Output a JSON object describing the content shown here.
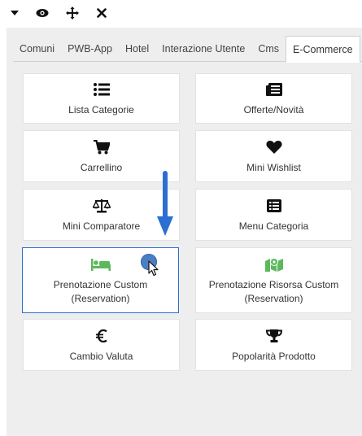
{
  "toolbar": {
    "icons": [
      "caret-down-icon",
      "eye-icon",
      "move-arrows-icon",
      "close-icon"
    ]
  },
  "tabs": [
    {
      "label": "Comuni",
      "active": false
    },
    {
      "label": "PWB-App",
      "active": false
    },
    {
      "label": "Hotel",
      "active": false
    },
    {
      "label": "Interazione Utente",
      "active": false
    },
    {
      "label": "Cms",
      "active": false
    },
    {
      "label": "E-Commerce",
      "active": true
    }
  ],
  "widgets": [
    {
      "label": "Lista Categorie",
      "icon": "list-icon",
      "color": "#111111"
    },
    {
      "label": "Offerte/Novità",
      "icon": "newspaper-icon",
      "color": "#111111"
    },
    {
      "label": "Carrellino",
      "icon": "shopping-cart-icon",
      "color": "#111111"
    },
    {
      "label": "Mini Wishlist",
      "icon": "heart-icon",
      "color": "#111111"
    },
    {
      "label": "Mini Comparatore",
      "icon": "balance-scale-icon",
      "color": "#111111"
    },
    {
      "label": "Menu Categoria",
      "icon": "list-alt-icon",
      "color": "#111111"
    },
    {
      "label": "Prenotazione Custom\n(Reservation)",
      "icon": "bed-icon",
      "color": "#5cb85c",
      "selected": true
    },
    {
      "label": "Prenotazione Risorsa Custom\n(Reservation)",
      "icon": "map-marker-icon",
      "color": "#5cb85c"
    },
    {
      "label": "Cambio Valuta",
      "icon": "euro-icon",
      "color": "#111111"
    },
    {
      "label": "Popolarità Prodotto",
      "icon": "trophy-icon",
      "color": "#111111"
    }
  ],
  "annotation": {
    "arrow_color": "#2a6fd1",
    "cursor_color": "#4a7fc4"
  }
}
